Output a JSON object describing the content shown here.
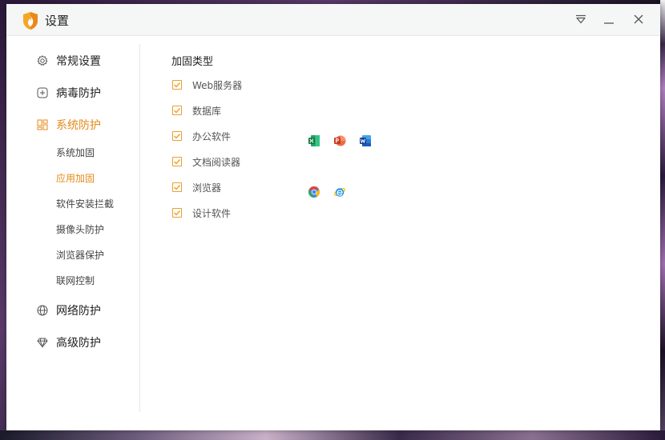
{
  "window": {
    "title": "设置"
  },
  "sidebar": {
    "items": [
      {
        "label": "常规设置",
        "icon": "gear-icon"
      },
      {
        "label": "病毒防护",
        "icon": "plus-square-icon"
      },
      {
        "label": "系统防护",
        "icon": "grid-icon",
        "active": true
      },
      {
        "label": "网络防护",
        "icon": "globe-icon"
      },
      {
        "label": "高级防护",
        "icon": "diamond-icon"
      }
    ],
    "sub_items": [
      {
        "label": "系统加固"
      },
      {
        "label": "应用加固",
        "active": true
      },
      {
        "label": "软件安装拦截"
      },
      {
        "label": "摄像头防护"
      },
      {
        "label": "浏览器保护"
      },
      {
        "label": "联网控制"
      }
    ]
  },
  "content": {
    "section_title": "加固类型",
    "options": [
      {
        "label": "Web服务器",
        "checked": true
      },
      {
        "label": "数据库",
        "checked": true
      },
      {
        "label": "办公软件",
        "checked": true,
        "icons": [
          "excel-icon",
          "powerpoint-icon",
          "word-icon"
        ]
      },
      {
        "label": "文档阅读器",
        "checked": true
      },
      {
        "label": "浏览器",
        "checked": true,
        "icons": [
          "chrome-icon",
          "ie-icon"
        ]
      },
      {
        "label": "设计软件",
        "checked": true
      }
    ]
  },
  "colors": {
    "accent": "#e48a1a",
    "checkbox_border": "#e8a030",
    "titlebar_bg": "#f5f6f6"
  }
}
